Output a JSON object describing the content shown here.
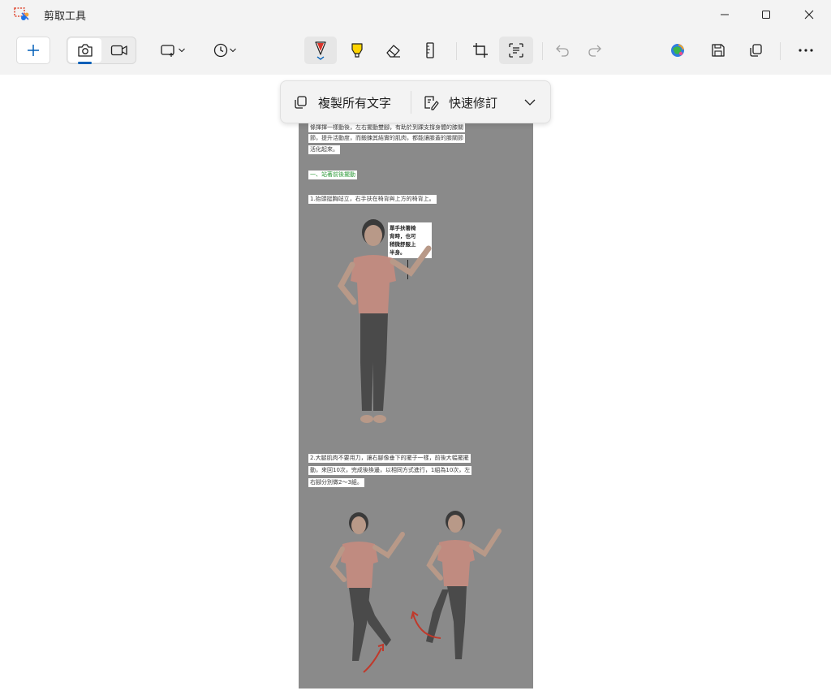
{
  "window": {
    "title": "剪取工具"
  },
  "toolbar": {
    "new_label": "",
    "items": [
      "new",
      "screenshot-mode",
      "video-mode",
      "snip-shape",
      "delay",
      "ballpoint-pen",
      "highlighter",
      "eraser",
      "ruler",
      "crop",
      "text-actions",
      "undo",
      "redo",
      "edit-in-paint3d",
      "save",
      "copy",
      "more"
    ]
  },
  "text_actions": {
    "copy_all_text": "複製所有文字",
    "quick_redact": "快速修訂"
  },
  "document": {
    "para1_line1": "條揮揮一樣動後，左右擺動雙腳，有助於到踝支撐身體的膝關",
    "para1_line2": "節，提升活動度，而鍛鍊其結實的肌肉，都能讓膝蓋的膝關節",
    "para1_line3": "活化起來。",
    "section_heading": "一、站著前後擺動",
    "step1": "1.抬頭挺胸站立，右手扶在椅背與上方的椅背上。",
    "annotation_l1": "單手扶著椅",
    "annotation_l2": "背時，也可",
    "annotation_l3": "稍微舒服上",
    "annotation_l4": "半身。",
    "step2_line1": "2.大腿肌肉不要用力，讓右腳像垂下的擺子一樣，前後大幅擺擺",
    "step2_line2": "動，來回10次，完成後換邊，以相同方式進行，1組為10次，左",
    "step2_line3": "右腳分別做2～3組。"
  },
  "colors": {
    "accent": "#005fb8",
    "heading_green": "#2e9b3a",
    "doc_gray": "#8a8a8a",
    "shirt": "#c98b7e",
    "pants": "#4a4a4a",
    "arrow": "#c0392b"
  }
}
